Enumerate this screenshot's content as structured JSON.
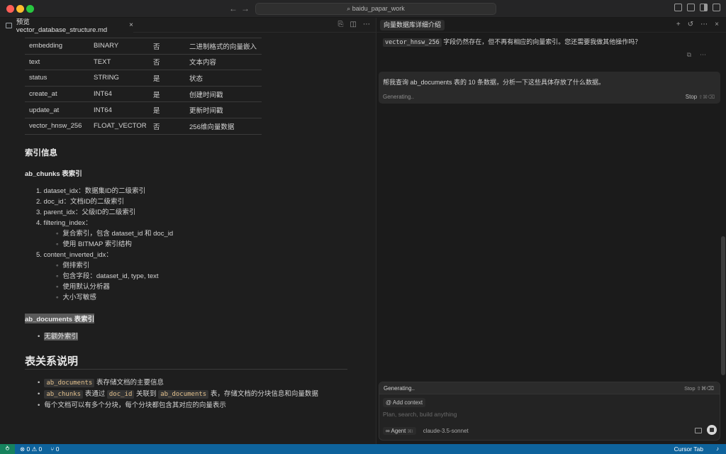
{
  "window": {
    "search_text": "baidu_papar_work",
    "back_icon": "←",
    "forward_icon": "→"
  },
  "editor": {
    "tab_label": "预览 vector_database_structure.md",
    "tab_close": "×",
    "fields_table": [
      [
        "embedding",
        "BINARY",
        "否",
        "二进制格式的向量嵌入"
      ],
      [
        "text",
        "TEXT",
        "否",
        "文本内容"
      ],
      [
        "status",
        "STRING",
        "是",
        "状态"
      ],
      [
        "create_at",
        "INT64",
        "是",
        "创建时间戳"
      ],
      [
        "update_at",
        "INT64",
        "是",
        "更新时间戳"
      ],
      [
        "vector_hnsw_256",
        "FLOAT_VECTOR",
        "否",
        "256维向量数据"
      ]
    ],
    "index_heading": "索引信息",
    "chunks_index_heading": "ab_chunks 表索引",
    "chunks_index_items": [
      "1. dataset_idx：数据集ID的二级索引",
      "2. doc_id：文档ID的二级索引",
      "3. parent_idx：父级ID的二级索引",
      "4. filtering_index：",
      "5. content_inverted_idx："
    ],
    "filtering_sub_items": [
      "复合索引，包含 dataset_id 和 doc_id",
      "使用 BITMAP 索引结构"
    ],
    "inverted_sub_items": [
      "倒排索引",
      "包含字段：dataset_id, type, text",
      "使用默认分析器",
      "大小写敏感"
    ],
    "documents_index_heading": "ab_documents 表索引",
    "documents_index_item": "无额外索引",
    "relations_heading": "表关系说明",
    "relations": {
      "line1_code": "ab_documents",
      "line1_text": " 表存储文档的主要信息",
      "line2_code_a": "ab_chunks",
      "line2_text_a": " 表通过 ",
      "line2_code_b": "doc_id",
      "line2_text_b": " 关联到 ",
      "line2_code_c": "ab_documents",
      "line2_text_c": " 表，存储文档的分块信息和向量数据",
      "line3_text": "每个文档可以有多个分块，每个分块都包含其对应的向量表示"
    }
  },
  "chat": {
    "tab_label": "向量数据库详细介绍",
    "header_actions": [
      "+",
      "↺",
      "⋯",
      "×"
    ],
    "assistant_code": "vector_hnsw_256",
    "assistant_text": " 字段仍然存在，但不再有相应的向量索引。您还需要我做其他操作吗？",
    "user_query": "帮我查询 ab_documents 表的 10 条数据，分析一下这些具体存放了什么数据。",
    "generating": "Generating..",
    "stop_label": "Stop",
    "stop_shortcut": "⇧⌘⌫",
    "composer": {
      "generating": "Generating..",
      "stop_label": "Stop ⇧⌘⌫",
      "add_context": "@ Add context",
      "placeholder": "Plan, search, build anything",
      "agent_label": "∞ Agent",
      "agent_shortcut": "⌘I",
      "model_label": "claude-3.5-sonnet"
    }
  },
  "statusbar": {
    "remote": "⥁",
    "problems": "⊗ 0 ⚠ 0",
    "ports": "⑂ 0",
    "cursor_tab": "Cursor Tab",
    "bell": "♪"
  },
  "colors": {
    "statusbar": "#0e639c",
    "remote": "#16825d",
    "inline_code": "#e2c08d"
  }
}
